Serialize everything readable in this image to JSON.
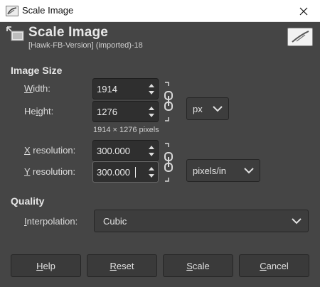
{
  "window": {
    "title": "Scale Image",
    "close_icon": "close-icon",
    "app_icon": "gimp-wilber-icon"
  },
  "header": {
    "title": "Scale Image",
    "subtitle": "[Hawk-FB-Version] (imported)-18",
    "icon": "scale-image-icon",
    "thumbnail": "image-thumbnail"
  },
  "image_size": {
    "title": "Image Size",
    "width_label": "Width:",
    "width_label_mnemonic": "W",
    "width_label_rest": "idth:",
    "width_value": "1914",
    "height_label": "Height:",
    "height_label_pre": "He",
    "height_label_mnemonic": "i",
    "height_label_rest": "ght:",
    "height_value": "1276",
    "unit": "px",
    "pixel_dims": "1914 × 1276 pixels",
    "x_res_label": "X resolution:",
    "x_res_mnemonic": "X",
    "x_res_rest": " resolution:",
    "x_res_value": "300.000",
    "y_res_label": "Y resolution:",
    "y_res_mnemonic": "Y",
    "y_res_rest": " resolution:",
    "y_res_value": "300.000",
    "res_unit": "pixels/in"
  },
  "quality": {
    "title": "Quality",
    "interp_label": "Interpolation:",
    "interp_mnemonic": "I",
    "interp_rest": "nterpolation:",
    "interp_value": "Cubic"
  },
  "buttons": {
    "help_mnemonic": "H",
    "help_rest": "elp",
    "reset_mnemonic": "R",
    "reset_rest": "eset",
    "scale_mnemonic": "S",
    "scale_rest": "cale",
    "cancel_mnemonic": "C",
    "cancel_rest": "ancel"
  }
}
